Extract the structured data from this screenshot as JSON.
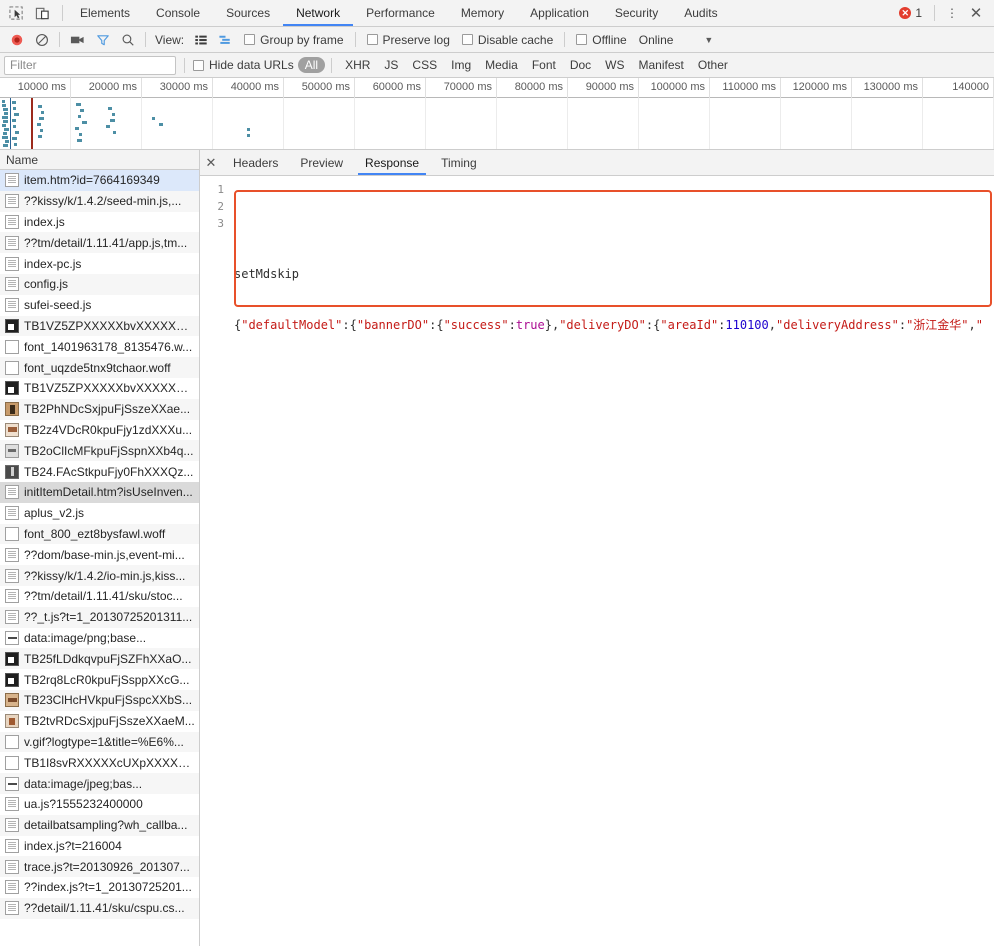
{
  "window": {
    "tool_icons": [
      "inspect-element-icon",
      "device-toolbar-icon"
    ],
    "tabs": [
      {
        "label": "Elements",
        "active": false
      },
      {
        "label": "Console",
        "active": false
      },
      {
        "label": "Sources",
        "active": false
      },
      {
        "label": "Network",
        "active": true
      },
      {
        "label": "Performance",
        "active": false
      },
      {
        "label": "Memory",
        "active": false
      },
      {
        "label": "Application",
        "active": false
      },
      {
        "label": "Security",
        "active": false
      },
      {
        "label": "Audits",
        "active": false
      }
    ],
    "error_count": "1",
    "more_label": "⋮",
    "close_label": "✕"
  },
  "toolbar": {
    "record_icon": "record-button-icon",
    "clear_icon": "clear-icon",
    "capture_screenshots_icon": "camera-icon",
    "filter_icon": "funnel-icon",
    "search_icon": "search-icon",
    "view_label": "View:",
    "view_list_icon": "list-view-icon",
    "view_waterfall_icon": "waterfall-view-icon",
    "group_by_frame": "Group by frame",
    "preserve_log": "Preserve log",
    "disable_cache": "Disable cache",
    "offline": "Offline",
    "throttle_value": "Online",
    "throttle_caret": "▼"
  },
  "filterbar": {
    "placeholder": "Filter",
    "value": "",
    "hide_data_urls": "Hide data URLs",
    "types": [
      {
        "label": "All",
        "selected": true
      },
      {
        "label": "XHR",
        "selected": false
      },
      {
        "label": "JS",
        "selected": false
      },
      {
        "label": "CSS",
        "selected": false
      },
      {
        "label": "Img",
        "selected": false
      },
      {
        "label": "Media",
        "selected": false
      },
      {
        "label": "Font",
        "selected": false
      },
      {
        "label": "Doc",
        "selected": false
      },
      {
        "label": "WS",
        "selected": false
      },
      {
        "label": "Manifest",
        "selected": false
      },
      {
        "label": "Other",
        "selected": false
      }
    ]
  },
  "overview": {
    "ticks": [
      "10000 ms",
      "20000 ms",
      "30000 ms",
      "40000 ms",
      "50000 ms",
      "60000 ms",
      "70000 ms",
      "80000 ms",
      "90000 ms",
      "100000 ms",
      "110000 ms",
      "120000 ms",
      "130000 ms",
      "140000"
    ],
    "dom_content_loaded_color": "#2a6496",
    "load_event_color": "#9c2a1c",
    "request_color": "#4d8fa5"
  },
  "requests": {
    "header": "Name",
    "items": [
      {
        "name": "item.htm?id=7664169349",
        "icon": "document-icon",
        "kind": "doc",
        "state": "selected"
      },
      {
        "name": "??kissy/k/1.4.2/seed-min.js,...",
        "icon": "script-icon",
        "kind": "doc",
        "state": ""
      },
      {
        "name": "index.js",
        "icon": "script-icon",
        "kind": "doc",
        "state": ""
      },
      {
        "name": "??tm/detail/1.11.41/app.js,tm...",
        "icon": "script-icon",
        "kind": "doc",
        "state": ""
      },
      {
        "name": "index-pc.js",
        "icon": "script-icon",
        "kind": "doc",
        "state": ""
      },
      {
        "name": "config.js",
        "icon": "script-icon",
        "kind": "doc",
        "state": ""
      },
      {
        "name": "sufei-seed.js",
        "icon": "script-icon",
        "kind": "doc",
        "state": ""
      },
      {
        "name": "TB1VZ5ZPXXXXXbvXXXXXXX...",
        "icon": "image-icon",
        "kind": "img1",
        "state": ""
      },
      {
        "name": "font_1401963178_8135476.w...",
        "icon": "font-icon",
        "kind": "plain",
        "state": ""
      },
      {
        "name": "font_uqzde5tnx9tchaor.woff",
        "icon": "font-icon",
        "kind": "plain",
        "state": ""
      },
      {
        "name": "TB1VZ5ZPXXXXXbvXXXXXXX...",
        "icon": "image-icon",
        "kind": "img1",
        "state": ""
      },
      {
        "name": "TB2PhNDcSxjpuFjSszeXXae...",
        "icon": "image-icon",
        "kind": "img2",
        "state": ""
      },
      {
        "name": "TB2z4VDcR0kpuFjy1zdXXXu...",
        "icon": "image-icon",
        "kind": "img3",
        "state": ""
      },
      {
        "name": "TB2oClIcMFkpuFjSspnXXb4q...",
        "icon": "image-icon",
        "kind": "img4",
        "state": ""
      },
      {
        "name": "TB24.FAcStkpuFjy0FhXXXQz...",
        "icon": "image-icon",
        "kind": "img5",
        "state": ""
      },
      {
        "name": "initItemDetail.htm?isUseInven...",
        "icon": "document-icon",
        "kind": "doc",
        "state": "hovered"
      },
      {
        "name": "aplus_v2.js",
        "icon": "script-icon",
        "kind": "doc",
        "state": ""
      },
      {
        "name": "font_800_ezt8bysfawl.woff",
        "icon": "font-icon",
        "kind": "plain",
        "state": ""
      },
      {
        "name": "??dom/base-min.js,event-mi...",
        "icon": "script-icon",
        "kind": "doc",
        "state": ""
      },
      {
        "name": "??kissy/k/1.4.2/io-min.js,kiss...",
        "icon": "script-icon",
        "kind": "doc",
        "state": ""
      },
      {
        "name": "??tm/detail/1.11.41/sku/stoc...",
        "icon": "script-icon",
        "kind": "doc",
        "state": ""
      },
      {
        "name": "??_t.js?t=1_20130725201311...",
        "icon": "script-icon",
        "kind": "doc",
        "state": ""
      },
      {
        "name": "data:image/png;base...",
        "icon": "image-icon",
        "kind": "other",
        "state": ""
      },
      {
        "name": "TB25fLDdkqvpuFjSZFhXXaO...",
        "icon": "image-icon",
        "kind": "img1",
        "state": ""
      },
      {
        "name": "TB2rq8LcR0kpuFjSsppXXcG...",
        "icon": "image-icon",
        "kind": "img1",
        "state": ""
      },
      {
        "name": "TB23ClHcHVkpuFjSspcXXbS...",
        "icon": "image-icon",
        "kind": "img6",
        "state": ""
      },
      {
        "name": "TB2tvRDcSxjpuFjSszeXXaeM...",
        "icon": "image-icon",
        "kind": "img7",
        "state": ""
      },
      {
        "name": "v.gif?logtype=1&title=%E6%...",
        "icon": "image-icon",
        "kind": "plain",
        "state": ""
      },
      {
        "name": "TB1I8svRXXXXXcUXpXXXXX...",
        "icon": "image-icon",
        "kind": "plain",
        "state": ""
      },
      {
        "name": "data:image/jpeg;bas...",
        "icon": "image-icon",
        "kind": "other",
        "state": ""
      },
      {
        "name": "ua.js?1555232400000",
        "icon": "script-icon",
        "kind": "doc",
        "state": ""
      },
      {
        "name": "detailbatsampling?wh_callba...",
        "icon": "script-icon",
        "kind": "doc",
        "state": ""
      },
      {
        "name": "index.js?t=216004",
        "icon": "script-icon",
        "kind": "doc",
        "state": ""
      },
      {
        "name": "trace.js?t=20130926_201307...",
        "icon": "script-icon",
        "kind": "doc",
        "state": ""
      },
      {
        "name": "??index.js?t=1_20130725201...",
        "icon": "script-icon",
        "kind": "doc",
        "state": ""
      },
      {
        "name": "??detail/1.11.41/sku/cspu.cs...",
        "icon": "script-icon",
        "kind": "doc",
        "state": ""
      }
    ]
  },
  "detail": {
    "close_label": "✕",
    "tabs": [
      {
        "label": "Headers",
        "active": false
      },
      {
        "label": "Preview",
        "active": false
      },
      {
        "label": "Response",
        "active": true
      },
      {
        "label": "Timing",
        "active": false
      }
    ],
    "line_numbers": [
      "1",
      "2",
      "3"
    ],
    "response": {
      "line1": "",
      "line2": "setMdskip",
      "line3_tokens": [
        {
          "t": "{",
          "c": "tok-punct"
        },
        {
          "t": "\"defaultModel\"",
          "c": "tok-key"
        },
        {
          "t": ":",
          "c": "tok-punct"
        },
        {
          "t": "{",
          "c": "tok-punct"
        },
        {
          "t": "\"bannerDO\"",
          "c": "tok-key"
        },
        {
          "t": ":",
          "c": "tok-punct"
        },
        {
          "t": "{",
          "c": "tok-punct"
        },
        {
          "t": "\"success\"",
          "c": "tok-key"
        },
        {
          "t": ":",
          "c": "tok-punct"
        },
        {
          "t": "true",
          "c": "tok-bool"
        },
        {
          "t": "},",
          "c": "tok-punct"
        },
        {
          "t": "\"deliveryDO\"",
          "c": "tok-key"
        },
        {
          "t": ":",
          "c": "tok-punct"
        },
        {
          "t": "{",
          "c": "tok-punct"
        },
        {
          "t": "\"areaId\"",
          "c": "tok-key"
        },
        {
          "t": ":",
          "c": "tok-punct"
        },
        {
          "t": "110100",
          "c": "tok-num"
        },
        {
          "t": ",",
          "c": "tok-punct"
        },
        {
          "t": "\"deliveryAddress\"",
          "c": "tok-key"
        },
        {
          "t": ":",
          "c": "tok-punct"
        },
        {
          "t": "\"浙江金华\"",
          "c": "tok-str"
        },
        {
          "t": ",",
          "c": "tok-punct"
        },
        {
          "t": "\"",
          "c": "tok-str"
        }
      ],
      "highlight_color": "#e8502a"
    }
  }
}
